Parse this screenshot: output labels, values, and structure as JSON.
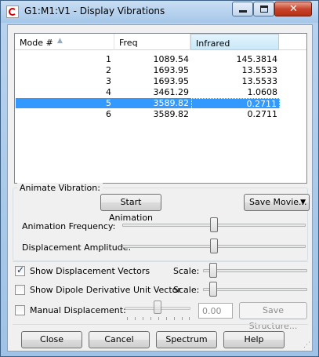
{
  "window": {
    "title": "G1:M1:V1 - Display Vibrations",
    "minimize_glyph": "‒",
    "close_glyph": "✕"
  },
  "table": {
    "headers": [
      "Mode #",
      "Freq",
      "Infrared"
    ],
    "sort_glyph": "▲",
    "rows": [
      {
        "mode": "1",
        "freq": "1089.54",
        "ir": "145.3814"
      },
      {
        "mode": "2",
        "freq": "1693.95",
        "ir": "13.5533"
      },
      {
        "mode": "3",
        "freq": "1693.95",
        "ir": "13.5533"
      },
      {
        "mode": "4",
        "freq": "3461.29",
        "ir": "1.0608"
      },
      {
        "mode": "5",
        "freq": "3589.82",
        "ir": "0.2711"
      },
      {
        "mode": "6",
        "freq": "3589.82",
        "ir": "0.2711"
      }
    ],
    "selected_mode": "5"
  },
  "animate": {
    "group_label": "Animate Vibration:",
    "start_button": "Start Animation",
    "save_movie_button": "Save Movie...",
    "dropdown_glyph": "▼",
    "frequency_label": "Animation Frequency:",
    "frequency_level": 0.5,
    "amplitude_label": "Displacement Amplitude:",
    "amplitude_level": 0.5
  },
  "options": {
    "show_displacement_vectors": {
      "label": "Show Displacement Vectors",
      "checked": true,
      "check_glyph": "✓"
    },
    "vectors_scale_label": "Scale:",
    "show_dipole": {
      "label": "Show Dipole Derivative Unit Vector",
      "checked": false
    },
    "dipole_scale_label": "Scale:",
    "manual_displacement": {
      "label": "Manual Displacement:",
      "checked": false
    },
    "manual_value": "0.00",
    "save_structure_button": "Save Structure..."
  },
  "buttons": {
    "close": "Close",
    "cancel": "Cancel",
    "spectrum": "Spectrum",
    "help": "Help"
  },
  "colors": {
    "selection": "#3399ff",
    "close_button": "#c7442a"
  }
}
